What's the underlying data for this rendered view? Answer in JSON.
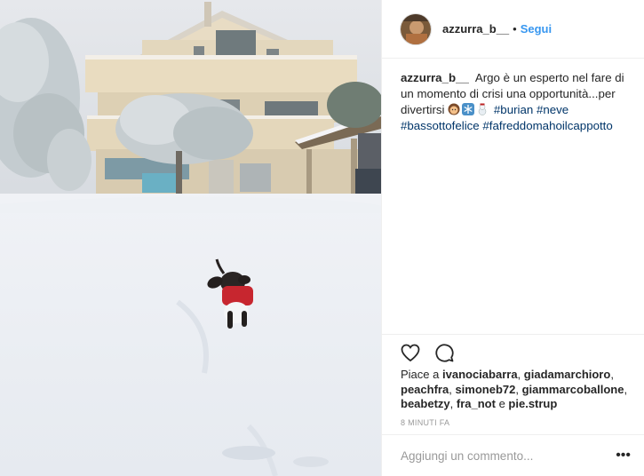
{
  "post": {
    "username": "azzurra_b__",
    "separator": "•",
    "follow_label": "Segui"
  },
  "caption": {
    "username": "azzurra_b__",
    "text": "Argo è un esperto nel fare di un momento di crisi una opportunità...per divertirsi",
    "emojis": [
      "woman-face-emoji",
      "snowflake-emoji",
      "snowman-emoji"
    ],
    "hashtags": [
      "#burian",
      "#neve",
      "#bassottofelice",
      "#fafreddomahoilcappotto"
    ]
  },
  "actions": {
    "like_icon": "heart-icon",
    "comment_icon": "comment-bubble-icon"
  },
  "likes": {
    "prefix": "Piace a",
    "users": [
      "ivanociabarra",
      "giadamarchioro",
      "peachfra",
      "simoneb72",
      "giammarcoballone",
      "beabetzy",
      "fra_not"
    ],
    "conjunction": "e",
    "last_user": "pie.strup"
  },
  "timestamp": "8 minuti fa",
  "comment": {
    "placeholder": "Aggiungi un commento...",
    "more_label": "•••"
  },
  "colors": {
    "link_blue": "#3897f0",
    "hashtag_blue": "#003569",
    "text": "#262626",
    "muted": "#999999",
    "border": "#efefef"
  }
}
